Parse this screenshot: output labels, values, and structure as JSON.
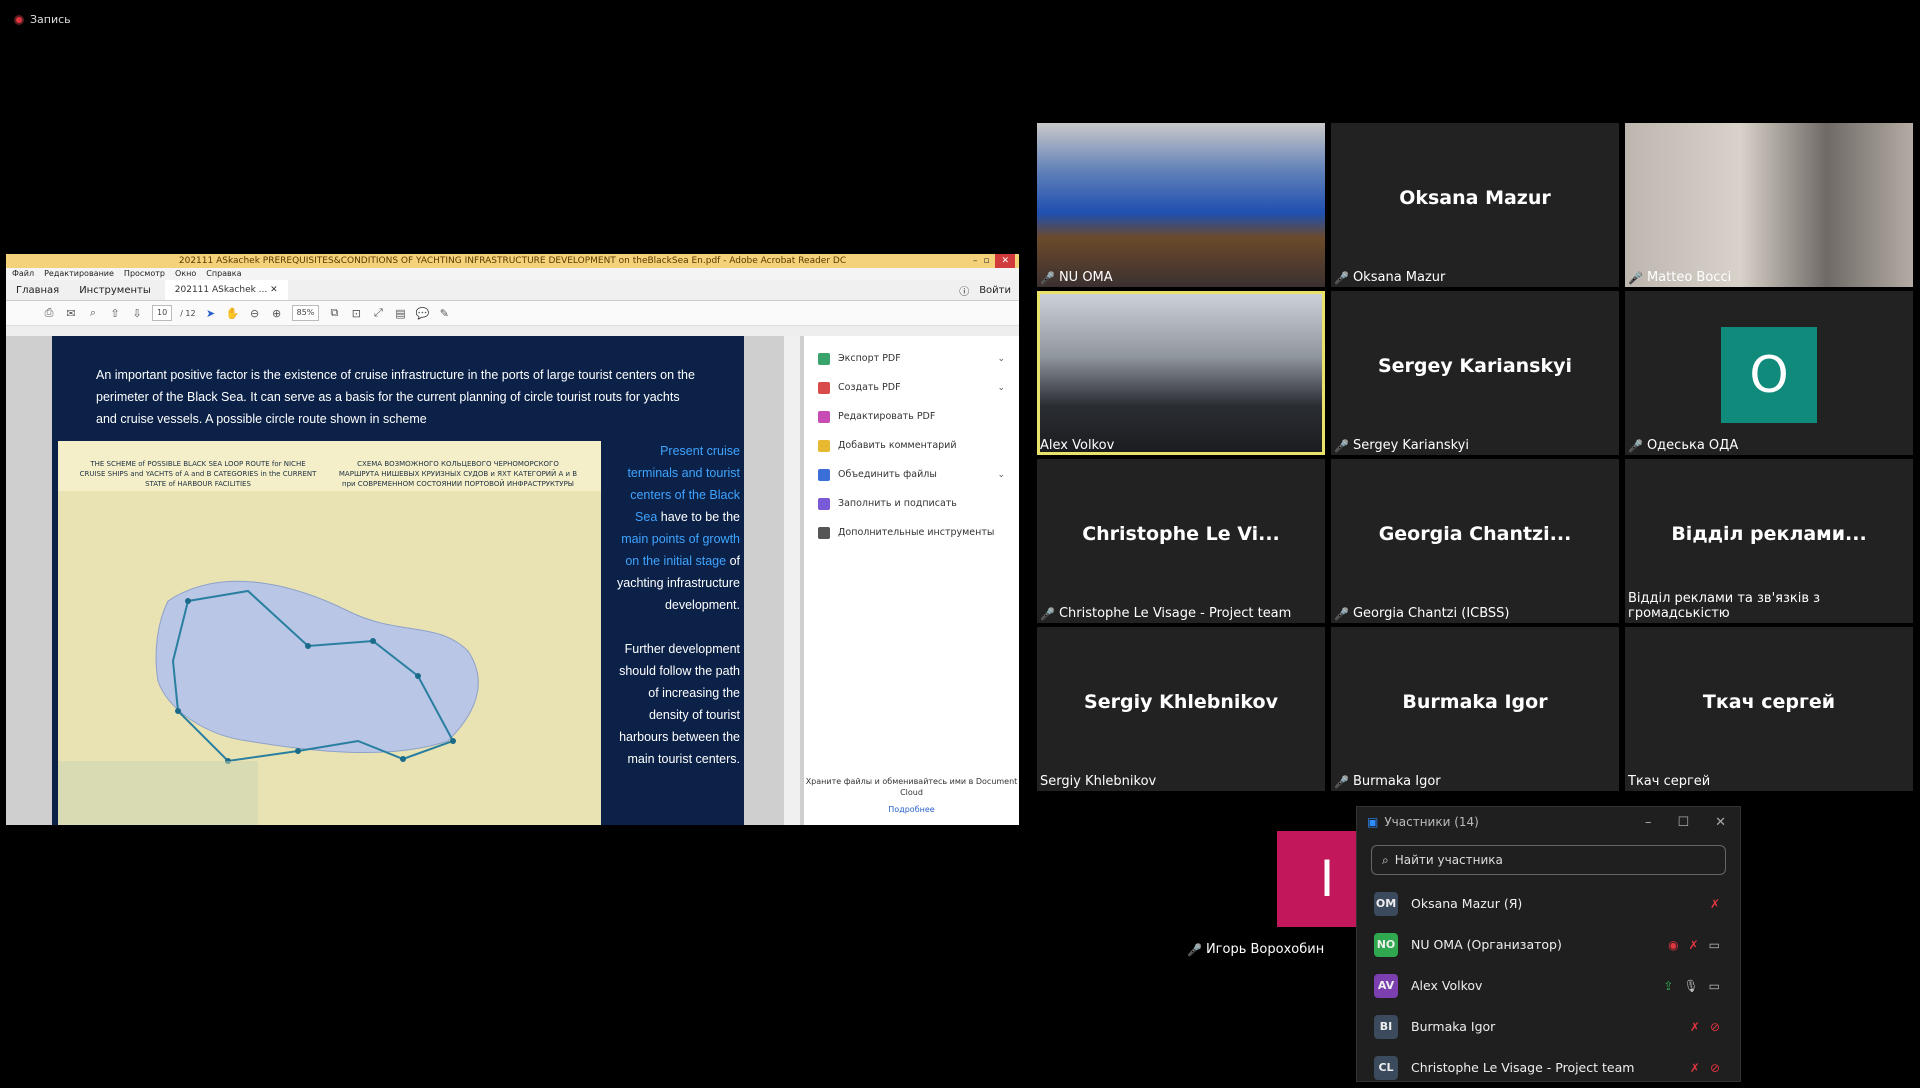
{
  "recording": {
    "label": "Запись"
  },
  "acrobat": {
    "title": "202111 ASkachek  PREREQUISITES&CONDITIONS OF YACHTING INFRASTRUCTURE DEVELOPMENT on theBlackSea En.pdf - Adobe Acrobat Reader DC",
    "menu": [
      "Файл",
      "Редактирование",
      "Просмотр",
      "Окно",
      "Справка"
    ],
    "tabs": {
      "home": "Главная",
      "tools": "Инструменты",
      "doc": "202111 ASkachek ...",
      "signin": "Войти"
    },
    "page_current": "10",
    "page_total": "/ 12",
    "zoom": "85%",
    "intro_text": "An important positive factor is the existence of cruise infrastructure in the ports of large tourist centers on the perimeter of the Black Sea. It can serve as a basis for the current planning of circle tourist routs for yachts and cruise vessels. A possible circle route shown in scheme",
    "map_header_en": "THE SCHEME of POSSIBLE BLACK SEA LOOP ROUTE for NICHE CRUISE SHIPS and YACHTS of A and B CATEGORIES in the CURRENT STATE of HARBOUR FACILITIES",
    "map_header_ru": "СХЕМА ВОЗМОЖНОГО КОЛЬЦЕВОГО ЧЕРНОМОРСКОГО МАРШРУТА НИШЕВЫХ КРУИЗНЫХ СУДОВ и ЯХТ КАТЕГОРИЙ А и В при СОВРЕМЕННОМ СОСТОЯНИИ ПОРТОВОЙ ИНФРАСТРУКТУРЫ",
    "side_hl1": "Present cruise terminals and tourist centers of the Black Sea",
    "side_w1": "have to be the",
    "side_hl2": "main points of growth on the initial stage",
    "side_w2": "of yachting infrastructure development.",
    "side_w3": "Further development should follow the path of increasing the density of tourist harbours between the main tourist centers.",
    "tools_panel": [
      {
        "label": "Экспорт PDF",
        "color": "#3aa36a",
        "chev": "⌄"
      },
      {
        "label": "Создать PDF",
        "color": "#d94b4b",
        "chev": "⌄"
      },
      {
        "label": "Редактировать PDF",
        "color": "#c64bb5",
        "chev": ""
      },
      {
        "label": "Добавить комментарий",
        "color": "#e8b830",
        "chev": ""
      },
      {
        "label": "Объединить файлы",
        "color": "#3b6fd8",
        "chev": "⌄"
      },
      {
        "label": "Заполнить и подписать",
        "color": "#7a5ad8",
        "chev": ""
      },
      {
        "label": "Дополнительные инструменты",
        "color": "#555555",
        "chev": ""
      }
    ],
    "cloud_text": "Храните файлы и обменивайтесь ими в Document Cloud",
    "cloud_link": "Подробнее"
  },
  "tiles": [
    {
      "label": "NU OMA",
      "name": "",
      "muted": true
    },
    {
      "label": "Oksana Mazur",
      "name": "Oksana Mazur",
      "muted": true
    },
    {
      "label": "Matteo Bocci",
      "name": "",
      "muted": true
    },
    {
      "label": "Alex Volkov",
      "name": "",
      "muted": false
    },
    {
      "label": "Sergey Karianskyi",
      "name": "Sergey Karianskyi",
      "muted": true
    },
    {
      "label": "Одеська ОДА",
      "name": "",
      "avatar": "O",
      "muted": true
    },
    {
      "label": "Christophe Le Visage - Project team",
      "name": "Christophe Le Vi...",
      "muted": true
    },
    {
      "label": "Georgia Chantzi (ICBSS)",
      "name": "Georgia Chantzi...",
      "muted": true
    },
    {
      "label": "Відділ реклами та зв'язків з громадськістю",
      "name": "Відділ реклами...",
      "muted": false
    },
    {
      "label": "Sergiy Khlebnikov",
      "name": "Sergiy Khlebnikov",
      "muted": false
    },
    {
      "label": "Burmaka Igor",
      "name": "Burmaka Igor",
      "muted": true
    },
    {
      "label": "Ткач сергей",
      "name": "Ткач сергей",
      "muted": false
    },
    {
      "label": "Игорь Ворохобин",
      "name": "",
      "avatar": "I",
      "muted": true
    }
  ],
  "participants": {
    "title": "Участники (14)",
    "search_placeholder": "Найти участника",
    "list": [
      {
        "initials": "OM",
        "name": "Oksana Mazur (Я)",
        "color": "#3b4a5c",
        "icons": [
          "mic-off"
        ]
      },
      {
        "initials": "NO",
        "name": "NU OMA (Организатор)",
        "color": "#2fa84f",
        "icons": [
          "record",
          "mic-off",
          "video"
        ]
      },
      {
        "initials": "AV",
        "name": "Alex Volkov",
        "color": "#7b3fb0",
        "icons": [
          "share",
          "mic",
          "video"
        ]
      },
      {
        "initials": "BI",
        "name": "Burmaka Igor",
        "color": "#3b4a5c",
        "icons": [
          "mic-off",
          "video-off"
        ]
      },
      {
        "initials": "CL",
        "name": "Christophe Le Visage - Project team",
        "color": "#3b4a5c",
        "icons": [
          "mic-off",
          "video-off"
        ]
      }
    ]
  }
}
